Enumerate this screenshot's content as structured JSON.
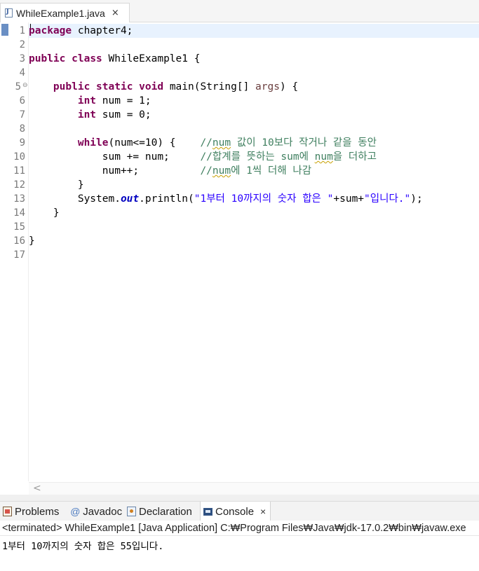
{
  "editor": {
    "tab": {
      "title": "WhileExample1.java",
      "close": "×",
      "icon": "java-file-icon"
    },
    "line_numbers": [
      "1",
      "2",
      "3",
      "4",
      "5",
      "6",
      "7",
      "8",
      "9",
      "10",
      "11",
      "12",
      "13",
      "14",
      "15",
      "16",
      "17"
    ],
    "fold_marker": "⊖",
    "code": {
      "l1_kw": "package",
      "l1_rest": " chapter4;",
      "l3_kw1": "public",
      "l3_kw2": "class",
      "l3_rest": " WhileExample1 {",
      "l5_indent": "    ",
      "l5_kw1": "public",
      "l5_kw2": "static",
      "l5_kw3": "void",
      "l5_mid": " main(String[] ",
      "l5_param": "args",
      "l5_end": ") {",
      "l6_indent": "        ",
      "l6_kw": "int",
      "l6_rest": " num = 1;",
      "l7_indent": "        ",
      "l7_kw": "int",
      "l7_rest": " sum = 0;",
      "l9_indent": "        ",
      "l9_kw": "while",
      "l9_rest": "(num<=10) {    ",
      "l9_c1": "//",
      "l9_c2": "num",
      "l9_c3": " 값이 10보다 작거나 같을 동안",
      "l10_code": "            sum += num;     ",
      "l10_c1": "//합계를 뜻하는 sum에 ",
      "l10_c2": "num",
      "l10_c3": "을 더하고",
      "l11_code": "            num++;          ",
      "l11_c1": "//",
      "l11_c2": "num",
      "l11_c3": "에 1씩 더해 나감",
      "l12_code": "        }",
      "l13_a": "        System.",
      "l13_field": "out",
      "l13_b": ".println(",
      "l13_s1": "\"1부터 10까지의 숫자 합은 \"",
      "l13_c": "+sum+",
      "l13_s2": "\"입니다.\"",
      "l13_d": ");",
      "l14_code": "    }",
      "l16_code": "}"
    },
    "scroll_left": "<"
  },
  "views": {
    "tabs": [
      {
        "label": "Problems",
        "icon": "problems-icon"
      },
      {
        "label": "Javadoc",
        "icon": "javadoc-icon",
        "glyph": "@"
      },
      {
        "label": "Declaration",
        "icon": "declaration-icon"
      },
      {
        "label": "Console",
        "icon": "console-icon",
        "active": true
      }
    ],
    "console_close": "×",
    "console_status": "<terminated> WhileExample1 [Java Application] C:₩Program Files₩Java₩jdk-17.0.2₩bin₩javaw.exe",
    "console_output": "1부터 10까지의 숫자 합은 55입니다."
  }
}
